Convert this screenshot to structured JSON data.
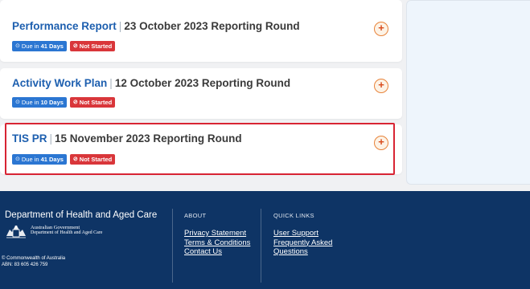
{
  "reports": [
    {
      "title": "Performance Report",
      "round": "23 October 2023 Reporting Round",
      "due_prefix": "Due in",
      "due_days": "41 Days",
      "status": "Not Started",
      "add_label": "+"
    },
    {
      "title": "Activity Work Plan",
      "round": "12 October 2023 Reporting Round",
      "due_prefix": "Due in",
      "due_days": "10 Days",
      "status": "Not Started",
      "add_label": "+"
    },
    {
      "title": "TIS PR",
      "round": "15 November 2023 Reporting Round",
      "due_prefix": "Due in",
      "due_days": "41 Days",
      "status": "Not Started",
      "add_label": "+"
    }
  ],
  "footer": {
    "department": "Department of Health and Aged Care",
    "gov_line1": "Australian Government",
    "gov_line2": "Department of Health and Aged Care",
    "copyright": "© Commonwealth of Australia",
    "abn": "ABN: 83 605 426 759",
    "about_title": "ABOUT",
    "about_links": [
      "Privacy Statement",
      "Terms & Conditions",
      "Contact Us"
    ],
    "quick_title": "QUICK LINKS",
    "quick_links": [
      "User Support",
      "Frequently Asked",
      "Questions"
    ]
  },
  "colors": {
    "link_blue": "#1d5faf",
    "badge_blue": "#2b76d2",
    "badge_red": "#d9363a",
    "highlight_red": "#d82433",
    "footer_navy": "#0e3465",
    "add_orange": "#e8833a"
  }
}
